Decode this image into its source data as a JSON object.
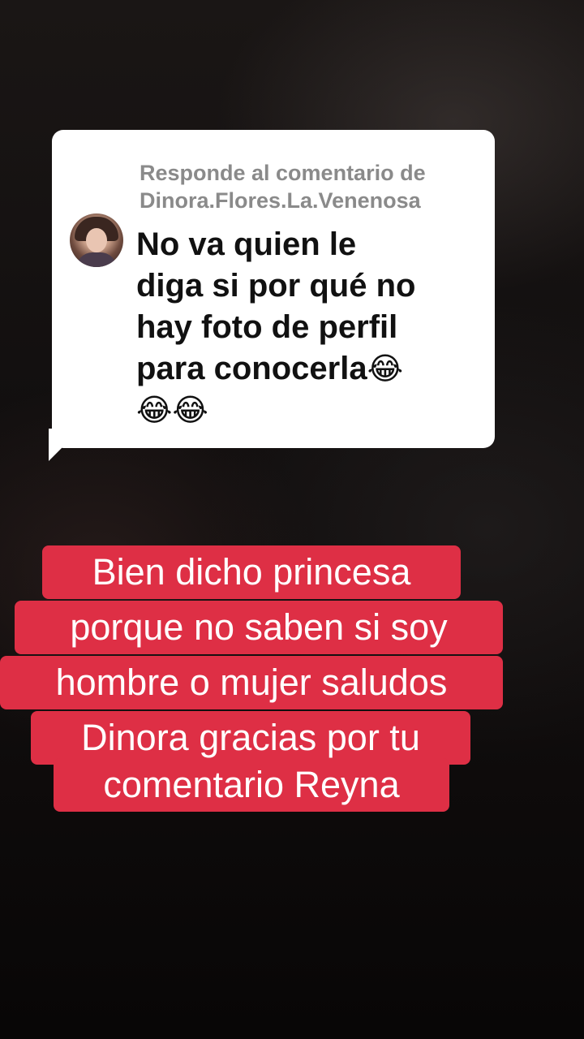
{
  "reply_bubble": {
    "header_line1": "Responde al comentario de",
    "header_line2": "Dinora.Flores.La.Venenosa",
    "comment_lines": [
      "No va quien le",
      "diga si por qué no",
      "hay foto de perfil",
      "para conocerla"
    ],
    "emoji_after_line4": "😂",
    "emoji_line5": "😂😂"
  },
  "caption": {
    "lines": [
      "Bien dicho princesa",
      "porque no saben si soy",
      "hombre o mujer saludos",
      "Dinora gracias por tu",
      "comentario Reyna"
    ]
  },
  "colors": {
    "caption_background": "#de2f45",
    "bubble_background": "#ffffff",
    "header_text": "#8a8a8a"
  }
}
